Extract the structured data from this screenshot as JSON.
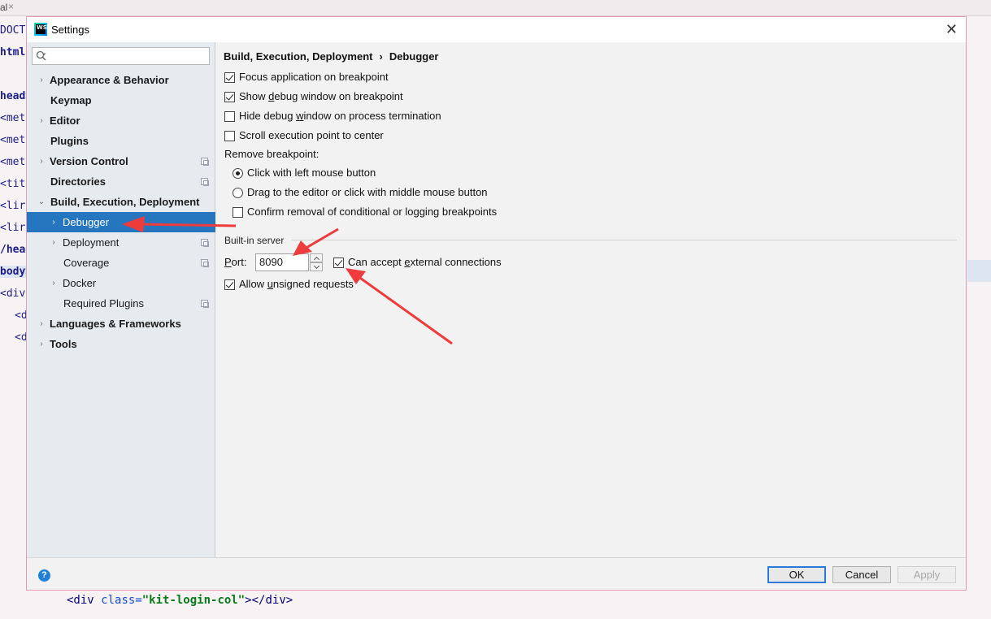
{
  "editor": {
    "tab_label": "al",
    "tab_close": "×",
    "code_lines": [
      "DOCT",
      "html",
      "head>",
      "<met",
      "<met",
      "<met",
      "<tit",
      "<lir",
      "<lir",
      "/head",
      "body>",
      "<div",
      "<d",
      "<d"
    ],
    "bottom_code_open": "<div ",
    "bottom_code_attr": "class=",
    "bottom_code_value": "\"kit-login-col\"",
    "bottom_code_close": "></div>"
  },
  "dialog": {
    "title": "Settings",
    "close_glyph": "✕",
    "logo_text": "WS"
  },
  "sidebar": {
    "search_placeholder": "",
    "items": [
      {
        "label": "Appearance & Behavior",
        "arrow": "›"
      },
      {
        "label": "Keymap"
      },
      {
        "label": "Editor",
        "arrow": "›"
      },
      {
        "label": "Plugins"
      },
      {
        "label": "Version Control",
        "arrow": "›"
      },
      {
        "label": "Directories"
      },
      {
        "label": "Build, Execution, Deployment",
        "arrow": "⌄"
      },
      {
        "label": "Debugger",
        "arrow": "›"
      },
      {
        "label": "Deployment",
        "arrow": "›"
      },
      {
        "label": "Coverage"
      },
      {
        "label": "Docker",
        "arrow": "›"
      },
      {
        "label": "Required Plugins"
      },
      {
        "label": "Languages & Frameworks",
        "arrow": "›"
      },
      {
        "label": "Tools",
        "arrow": "›"
      }
    ]
  },
  "content": {
    "breadcrumb_parent": "Build, Execution, Deployment",
    "breadcrumb_sep": "›",
    "breadcrumb_current": "Debugger",
    "options": [
      {
        "label": "Focus application on breakpoint",
        "checked": true
      },
      {
        "label_pre": "Show ",
        "label_u": "d",
        "label_post": "ebug window on breakpoint",
        "checked": true
      },
      {
        "label_pre": "Hide debug ",
        "label_u": "w",
        "label_post": "indow on process termination",
        "checked": false
      },
      {
        "label": "Scroll execution point to center",
        "checked": false
      }
    ],
    "remove_breakpoint_label": "Remove breakpoint:",
    "remove_options": [
      {
        "label": "Click with left mouse button",
        "checked": true
      },
      {
        "label": "Drag to the editor or click with middle mouse button",
        "checked": false
      }
    ],
    "confirm_removal": {
      "label": "Confirm removal of conditional or logging breakpoints",
      "checked": false
    },
    "builtin_server_label": "Built-in server",
    "port_label_u": "P",
    "port_label_rest": "ort:",
    "port_value": "8090",
    "external_pre": "Can accept ",
    "external_u": "e",
    "external_post": "xternal connections",
    "external_checked": true,
    "unsigned_pre": "Allow ",
    "unsigned_u": "u",
    "unsigned_post": "nsigned requests",
    "unsigned_checked": true
  },
  "footer": {
    "help": "?",
    "ok": "OK",
    "cancel": "Cancel",
    "apply": "Apply"
  },
  "colors": {
    "selection": "#2675bf",
    "annotation_arrow": "#ee3b3b",
    "dialog_border": "#e89ab8"
  }
}
